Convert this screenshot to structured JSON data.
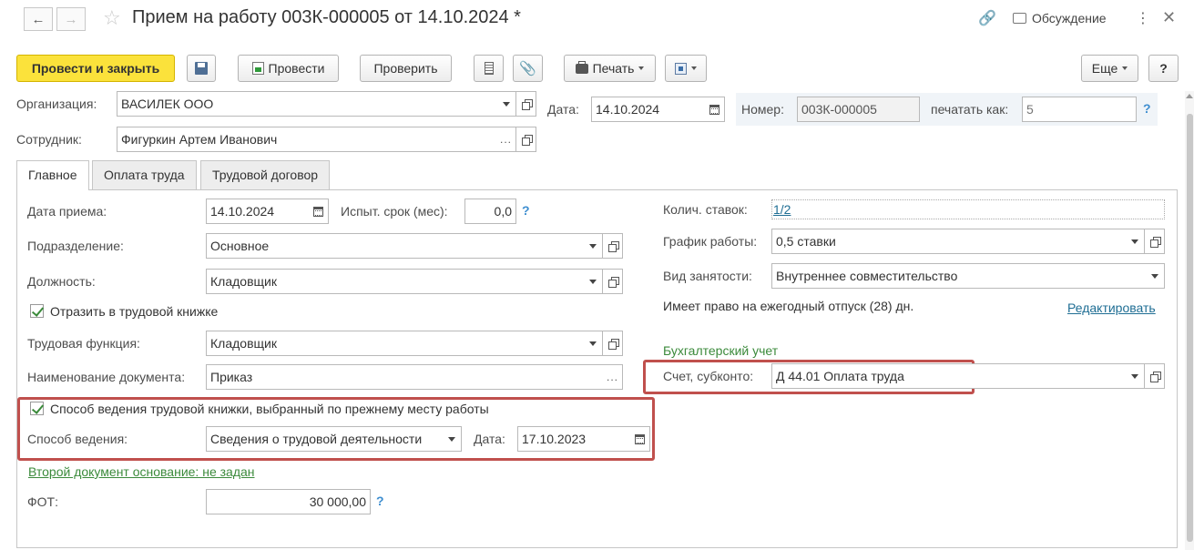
{
  "window": {
    "title": "Прием на работу 003К-000005 от 14.10.2024 *",
    "discuss_label": "Обсуждение"
  },
  "toolbar": {
    "post_close": "Провести и закрыть",
    "post": "Провести",
    "check": "Проверить",
    "print": "Печать",
    "more": "Еще",
    "help": "?"
  },
  "header": {
    "org_label": "Организация:",
    "org_value": "ВАСИЛЕК ООО",
    "date_label": "Дата:",
    "date_value": "14.10.2024",
    "number_label": "Номер:",
    "number_value": "003К-000005",
    "print_as_label": "печатать как:",
    "print_as_placeholder": "5",
    "employee_label": "Сотрудник:",
    "employee_value": "Фигуркин Артем Иванович"
  },
  "tabs": [
    {
      "label": "Главное"
    },
    {
      "label": "Оплата труда"
    },
    {
      "label": "Трудовой договор"
    }
  ],
  "main": {
    "hire_date_label": "Дата приема:",
    "hire_date_value": "14.10.2024",
    "trial_label": "Испыт. срок (мес):",
    "trial_value": "0,0",
    "department_label": "Подразделение:",
    "department_value": "Основное",
    "position_label": "Должность:",
    "position_value": "Кладовщик",
    "workbook_check_label": "Отразить в трудовой книжке",
    "labor_function_label": "Трудовая функция:",
    "labor_function_value": "Кладовщик",
    "doc_name_label": "Наименование документа:",
    "doc_name_value": "Приказ",
    "keeping_check_label": "Способ ведения трудовой книжки, выбранный по прежнему месту работы",
    "keeping_method_label": "Способ ведения:",
    "keeping_method_value": "Сведения о трудовой деятельности",
    "keeping_date_label": "Дата:",
    "keeping_date_value": "17.10.2023",
    "second_doc_link": "Второй документ основание: не задан",
    "fot_label": "ФОТ:",
    "fot_value": "30 000,00"
  },
  "right": {
    "rates_label": "Колич. ставок:",
    "rates_value": "1/2",
    "schedule_label": "График работы:",
    "schedule_value": "0,5 ставки",
    "employment_label": "Вид занятости:",
    "employment_value": "Внутреннее совместительство",
    "vacation_text": "Имеет право на ежегодный отпуск (28) дн.",
    "edit_link": "Редактировать",
    "accounting_header": "Бухгалтерский учет",
    "account_label": "Счет, субконто:",
    "account_value": "Д 44.01 Оплата труда"
  }
}
